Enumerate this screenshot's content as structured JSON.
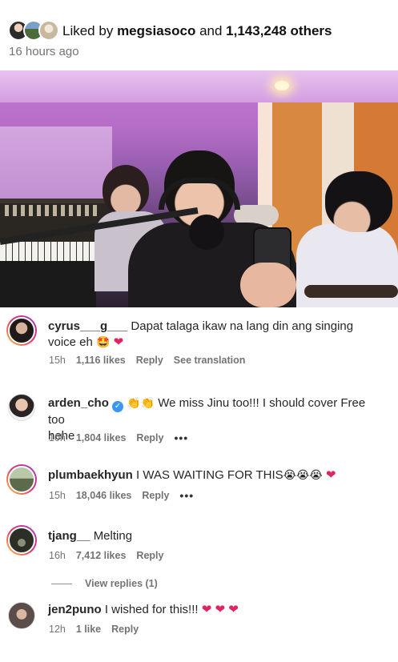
{
  "post": {
    "liked_prefix": "Liked by",
    "liked_user": "megsiasoco",
    "liked_and": "and",
    "liked_others": "1,143,248 others",
    "time_ago": "16 hours ago"
  },
  "comments": [
    {
      "username": "cyrus___g___",
      "text": "Dapat talaga ikaw na lang din ang singing voice eh",
      "emojis": "🤩",
      "time": "15h",
      "likes": "1,116 likes",
      "reply": "Reply",
      "translation": "See translation"
    },
    {
      "username": "arden_cho",
      "emojis_prefix": "👏👏",
      "text_line1": "We miss Jinu too!!! I should cover Free too",
      "text_line2": "hehe",
      "time": "10h",
      "likes": "1,804 likes",
      "reply": "Reply",
      "more": "•••"
    },
    {
      "username": "plumbaekhyun",
      "text": "I WAS WAITING FOR THIS",
      "emojis": "😭😭😭",
      "time": "15h",
      "likes": "18,046 likes",
      "reply": "Reply",
      "more": "•••"
    },
    {
      "username": "tjang__",
      "text": "Melting",
      "time": "16h",
      "likes": "7,412 likes",
      "reply": "Reply"
    },
    {
      "username": "jen2puno",
      "text": "I wished for this!!!",
      "time": "12h",
      "likes": "1 like",
      "reply": "Reply"
    }
  ],
  "view_replies": "View replies (1)",
  "colors": {
    "heart": "#e0245e",
    "meta_gray": "#737373",
    "story_ring": [
      "#f9c53a",
      "#e1306c",
      "#a23bd1"
    ]
  }
}
